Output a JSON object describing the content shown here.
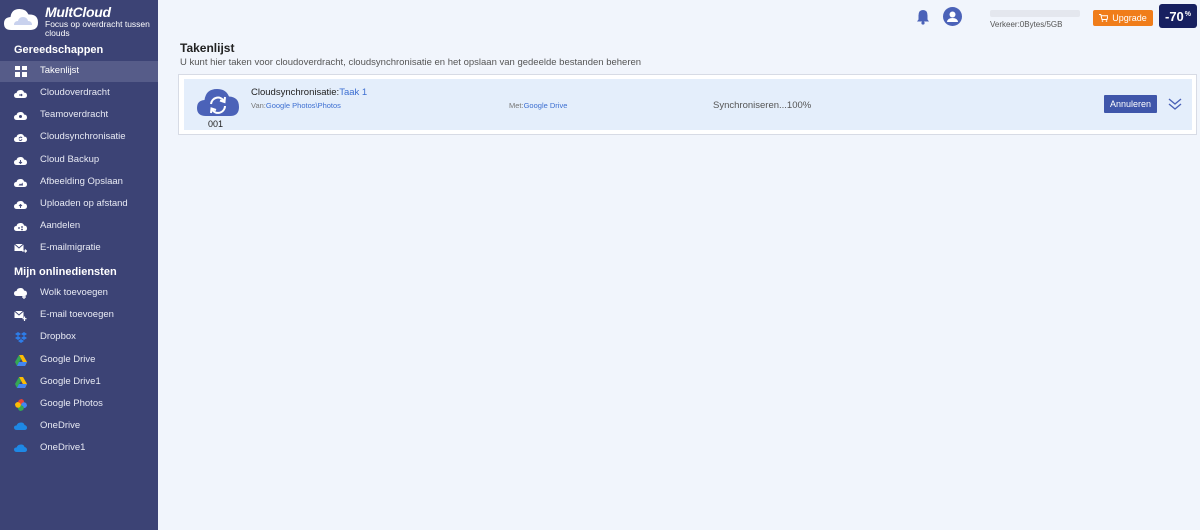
{
  "brand": {
    "name": "MultCloud",
    "tagline": "Focus op overdracht tussen clouds"
  },
  "sidebar": {
    "tools_title": "Gereedschappen",
    "tools": [
      {
        "label": "Takenlijst",
        "icon": "grid-icon",
        "active": true
      },
      {
        "label": "Cloudoverdracht",
        "icon": "cloud-transfer-icon"
      },
      {
        "label": "Teamoverdracht",
        "icon": "team-transfer-icon"
      },
      {
        "label": "Cloudsynchronisatie",
        "icon": "cloud-sync-icon"
      },
      {
        "label": "Cloud Backup",
        "icon": "cloud-backup-icon"
      },
      {
        "label": "Afbeelding Opslaan",
        "icon": "image-save-icon"
      },
      {
        "label": "Uploaden op afstand",
        "icon": "remote-upload-icon"
      },
      {
        "label": "Aandelen",
        "icon": "share-icon"
      },
      {
        "label": "E-mailmigratie",
        "icon": "email-migration-icon"
      }
    ],
    "services_title": "Mijn onlinediensten",
    "services": [
      {
        "label": "Wolk toevoegen",
        "icon": "add-cloud-icon"
      },
      {
        "label": "E-mail toevoegen",
        "icon": "add-email-icon"
      },
      {
        "label": "Dropbox",
        "icon": "dropbox-icon"
      },
      {
        "label": "Google Drive",
        "icon": "google-drive-icon"
      },
      {
        "label": "Google Drive1",
        "icon": "google-drive-icon"
      },
      {
        "label": "Google Photos",
        "icon": "google-photos-icon"
      },
      {
        "label": "OneDrive",
        "icon": "onedrive-icon"
      },
      {
        "label": "OneDrive1",
        "icon": "onedrive-icon"
      }
    ]
  },
  "topbar": {
    "traffic": "Verkeer:0Bytes/5GB",
    "upgrade_label": "Upgrade",
    "promo": "-70",
    "promo_pct": "%"
  },
  "page": {
    "title": "Takenlijst",
    "subtitle": "U kunt hier taken voor cloudoverdracht, cloudsynchronisatie en het opslaan van gedeelde bestanden beheren"
  },
  "task": {
    "number": "001",
    "type": "Cloudsynchronisatie:",
    "name": "Taak 1",
    "from_label": "Van:",
    "from_value": "Google Photos\\Photos",
    "to_label": "Met:",
    "to_value": "Google Drive",
    "status": "Synchroniseren...100%",
    "cancel_label": "Annuleren"
  },
  "colors": {
    "sidebar_bg": "#3c4375",
    "accent": "#3f56aa",
    "upgrade": "#f07d1a",
    "link": "#3d6fd1"
  }
}
